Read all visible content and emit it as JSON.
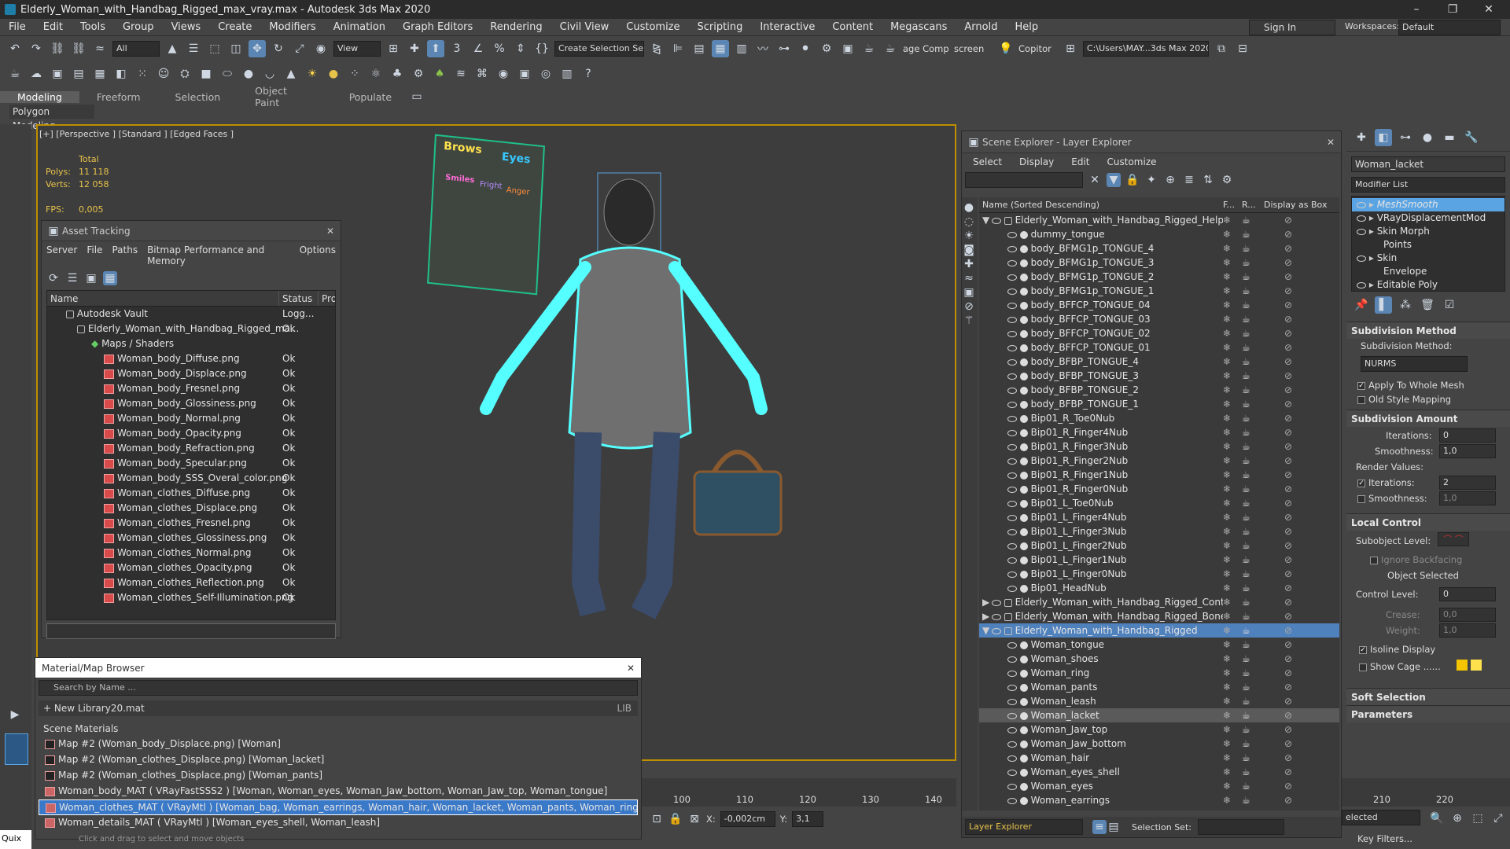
{
  "window": {
    "title": "Elderly_Woman_with_Handbag_Rigged_max_vray.max - Autodesk 3ds Max 2020",
    "minimize": "–",
    "maximize": "❐",
    "close": "✕"
  },
  "menu": [
    "File",
    "Edit",
    "Tools",
    "Group",
    "Views",
    "Create",
    "Modifiers",
    "Animation",
    "Graph Editors",
    "Rendering",
    "Civil View",
    "Customize",
    "Scripting",
    "Interactive",
    "Content",
    "Megascans",
    "Arnold",
    "Help"
  ],
  "account": {
    "signin": "Sign In",
    "workspaces_label": "Workspaces:",
    "workspace": "Default"
  },
  "toolbar": {
    "filter": "All",
    "view": "View",
    "selection_set": "Create Selection Se",
    "item_comp": "age Comp Help",
    "item_screen": "screen",
    "item_copitor": "Copitor",
    "path": "C:\\Users\\MAY...3ds Max 2020"
  },
  "ribbon": {
    "tabs": [
      "Modeling",
      "Freeform",
      "Selection",
      "Object Paint",
      "Populate"
    ],
    "sub": "Polygon Modeling"
  },
  "viewport": {
    "label": "[+] [Perspective ] [Standard ] [Edged Faces ]",
    "stats_total": "Total",
    "polys_label": "Polys:",
    "polys": "11 118",
    "verts_label": "Verts:",
    "verts": "12 058",
    "fps_label": "FPS:",
    "fps": "0,005",
    "board": {
      "brows": "Brows",
      "eyes": "Eyes",
      "smiles": "Smiles",
      "fright": "Fright",
      "anger": "Anger"
    }
  },
  "asset_tracking": {
    "title": "Asset Tracking",
    "menu": [
      "Server",
      "File",
      "Paths",
      "Bitmap Performance and Memory",
      "Options"
    ],
    "cols": [
      "Name",
      "Status",
      "Pro"
    ],
    "vault": "Autodesk Vault",
    "vault_status": "Logg...",
    "file": "Elderly_Woman_with_Handbag_Rigged_ma...",
    "file_status": "Ok",
    "maps": "Maps / Shaders",
    "items": [
      "Woman_body_Diffuse.png",
      "Woman_body_Displace.png",
      "Woman_body_Fresnel.png",
      "Woman_body_Glossiness.png",
      "Woman_body_Normal.png",
      "Woman_body_Opacity.png",
      "Woman_body_Refraction.png",
      "Woman_body_Specular.png",
      "Woman_body_SSS_Overal_color.png",
      "Woman_clothes_Diffuse.png",
      "Woman_clothes_Displace.png",
      "Woman_clothes_Fresnel.png",
      "Woman_clothes_Glossiness.png",
      "Woman_clothes_Normal.png",
      "Woman_clothes_Opacity.png",
      "Woman_clothes_Reflection.png",
      "Woman_clothes_Self-Illumination.png"
    ],
    "ok": "Ok"
  },
  "material_browser": {
    "title": "Material/Map Browser",
    "search": "Search by Name ...",
    "library": "+ New Library20.mat",
    "lib": "LIB",
    "scene": "Scene Materials",
    "items": [
      "Map #2 (Woman_body_Displace.png) [Woman]",
      "Map #2 (Woman_clothes_Displace.png) [Woman_lacket]",
      "Map #2 (Woman_clothes_Displace.png) [Woman_pants]",
      "Woman_body_MAT ( VRayFastSSS2 ) [Woman, Woman_eyes, Woman_Jaw_bottom, Woman_Jaw_top, Woman_tongue]",
      "Woman_clothes_MAT ( VRayMtl ) [Woman_bag, Woman_earrings, Woman_hair, Woman_lacket, Woman_pants, Woman_ring, Woman_sh...",
      "Woman_details_MAT ( VRayMtl ) [Woman_eyes_shell, Woman_leash]"
    ]
  },
  "scene_explorer": {
    "title": "Scene Explorer - Layer Explorer",
    "menu": [
      "Select",
      "Display",
      "Edit",
      "Customize"
    ],
    "col_name": "Name (Sorted Descending)",
    "col_f": "F...",
    "col_r": "R...",
    "col_box": "Display as Box",
    "helpers": "Elderly_Woman_with_Handbag_Rigged_Helpers",
    "helper_items": [
      "dummy_tongue",
      "body_BFMG1p_TONGUE_4",
      "body_BFMG1p_TONGUE_3",
      "body_BFMG1p_TONGUE_2",
      "body_BFMG1p_TONGUE_1",
      "body_BFFCP_TONGUE_04",
      "body_BFFCP_TONGUE_03",
      "body_BFFCP_TONGUE_02",
      "body_BFFCP_TONGUE_01",
      "body_BFBP_TONGUE_4",
      "body_BFBP_TONGUE_3",
      "body_BFBP_TONGUE_2",
      "body_BFBP_TONGUE_1",
      "Bip01_R_Toe0Nub",
      "Bip01_R_Finger4Nub",
      "Bip01_R_Finger3Nub",
      "Bip01_R_Finger2Nub",
      "Bip01_R_Finger1Nub",
      "Bip01_R_Finger0Nub",
      "Bip01_L_Toe0Nub",
      "Bip01_L_Finger4Nub",
      "Bip01_L_Finger3Nub",
      "Bip01_L_Finger2Nub",
      "Bip01_L_Finger1Nub",
      "Bip01_L_Finger0Nub",
      "Bip01_HeadNub"
    ],
    "controllers": "Elderly_Woman_with_Handbag_Rigged_Controllers",
    "bones": "Elderly_Woman_with_Handbag_Rigged_Bones",
    "rigged": "Elderly_Woman_with_Handbag_Rigged",
    "rigged_items": [
      "Woman_tongue",
      "Woman_shoes",
      "Woman_ring",
      "Woman_pants",
      "Woman_leash",
      "Woman_lacket",
      "Woman_Jaw_top",
      "Woman_Jaw_bottom",
      "Woman_hair",
      "Woman_eyes_shell",
      "Woman_eyes",
      "Woman_earrings"
    ],
    "footer_layer": "Layer Explorer",
    "footer_selset": "Selection Set:"
  },
  "command_panel": {
    "object_name": "Woman_lacket",
    "modifier_list": "Modifier List",
    "stack": [
      {
        "label": "MeshSmooth",
        "sel": true
      },
      {
        "label": "VRayDisplacementMod"
      },
      {
        "label": "Skin Morph"
      },
      {
        "label": "Points"
      },
      {
        "label": "Skin"
      },
      {
        "label": "Envelope"
      },
      {
        "label": "Editable Poly"
      }
    ],
    "subdiv_method_title": "Subdivision Method",
    "subdiv_method_label": "Subdivision Method:",
    "subdiv_method": "NURMS",
    "apply_whole": "Apply To Whole Mesh",
    "old_style": "Old Style Mapping",
    "subdiv_amount_title": "Subdivision Amount",
    "iterations_label": "Iterations:",
    "iterations": "0",
    "smoothness_label": "Smoothness:",
    "smoothness": "1,0",
    "render_values": "Render Values:",
    "r_iterations": "2",
    "r_smoothness": "1,0",
    "local_control_title": "Local Control",
    "subobject_level": "Subobject Level:",
    "ignore_backfacing": "Ignore Backfacing",
    "object_selected": "Object Selected",
    "control_level_label": "Control Level:",
    "control_level": "0",
    "crease_label": "Crease:",
    "crease": "0,0",
    "weight_label": "Weight:",
    "weight": "1,0",
    "isoline": "Isoline Display",
    "show_cage": "Show Cage ......",
    "soft_selection": "Soft Selection",
    "parameters": "Parameters"
  },
  "timeline": {
    "ticks": [
      "100",
      "110",
      "120",
      "130",
      "140",
      "210",
      "220"
    ]
  },
  "status": {
    "x_label": "X:",
    "x": "-0,002cm",
    "y_label": "Y:",
    "y": "3,1",
    "selected": "elected",
    "key_filters": "Key Filters...",
    "hint": "Click and drag to select and move objects",
    "maxscript": "Quix"
  },
  "colors": {
    "accent": "#5ba4e3",
    "viewport_border": "#bf8f00",
    "selected_row": "#4f81bd",
    "highlight": "#3a78c8"
  }
}
